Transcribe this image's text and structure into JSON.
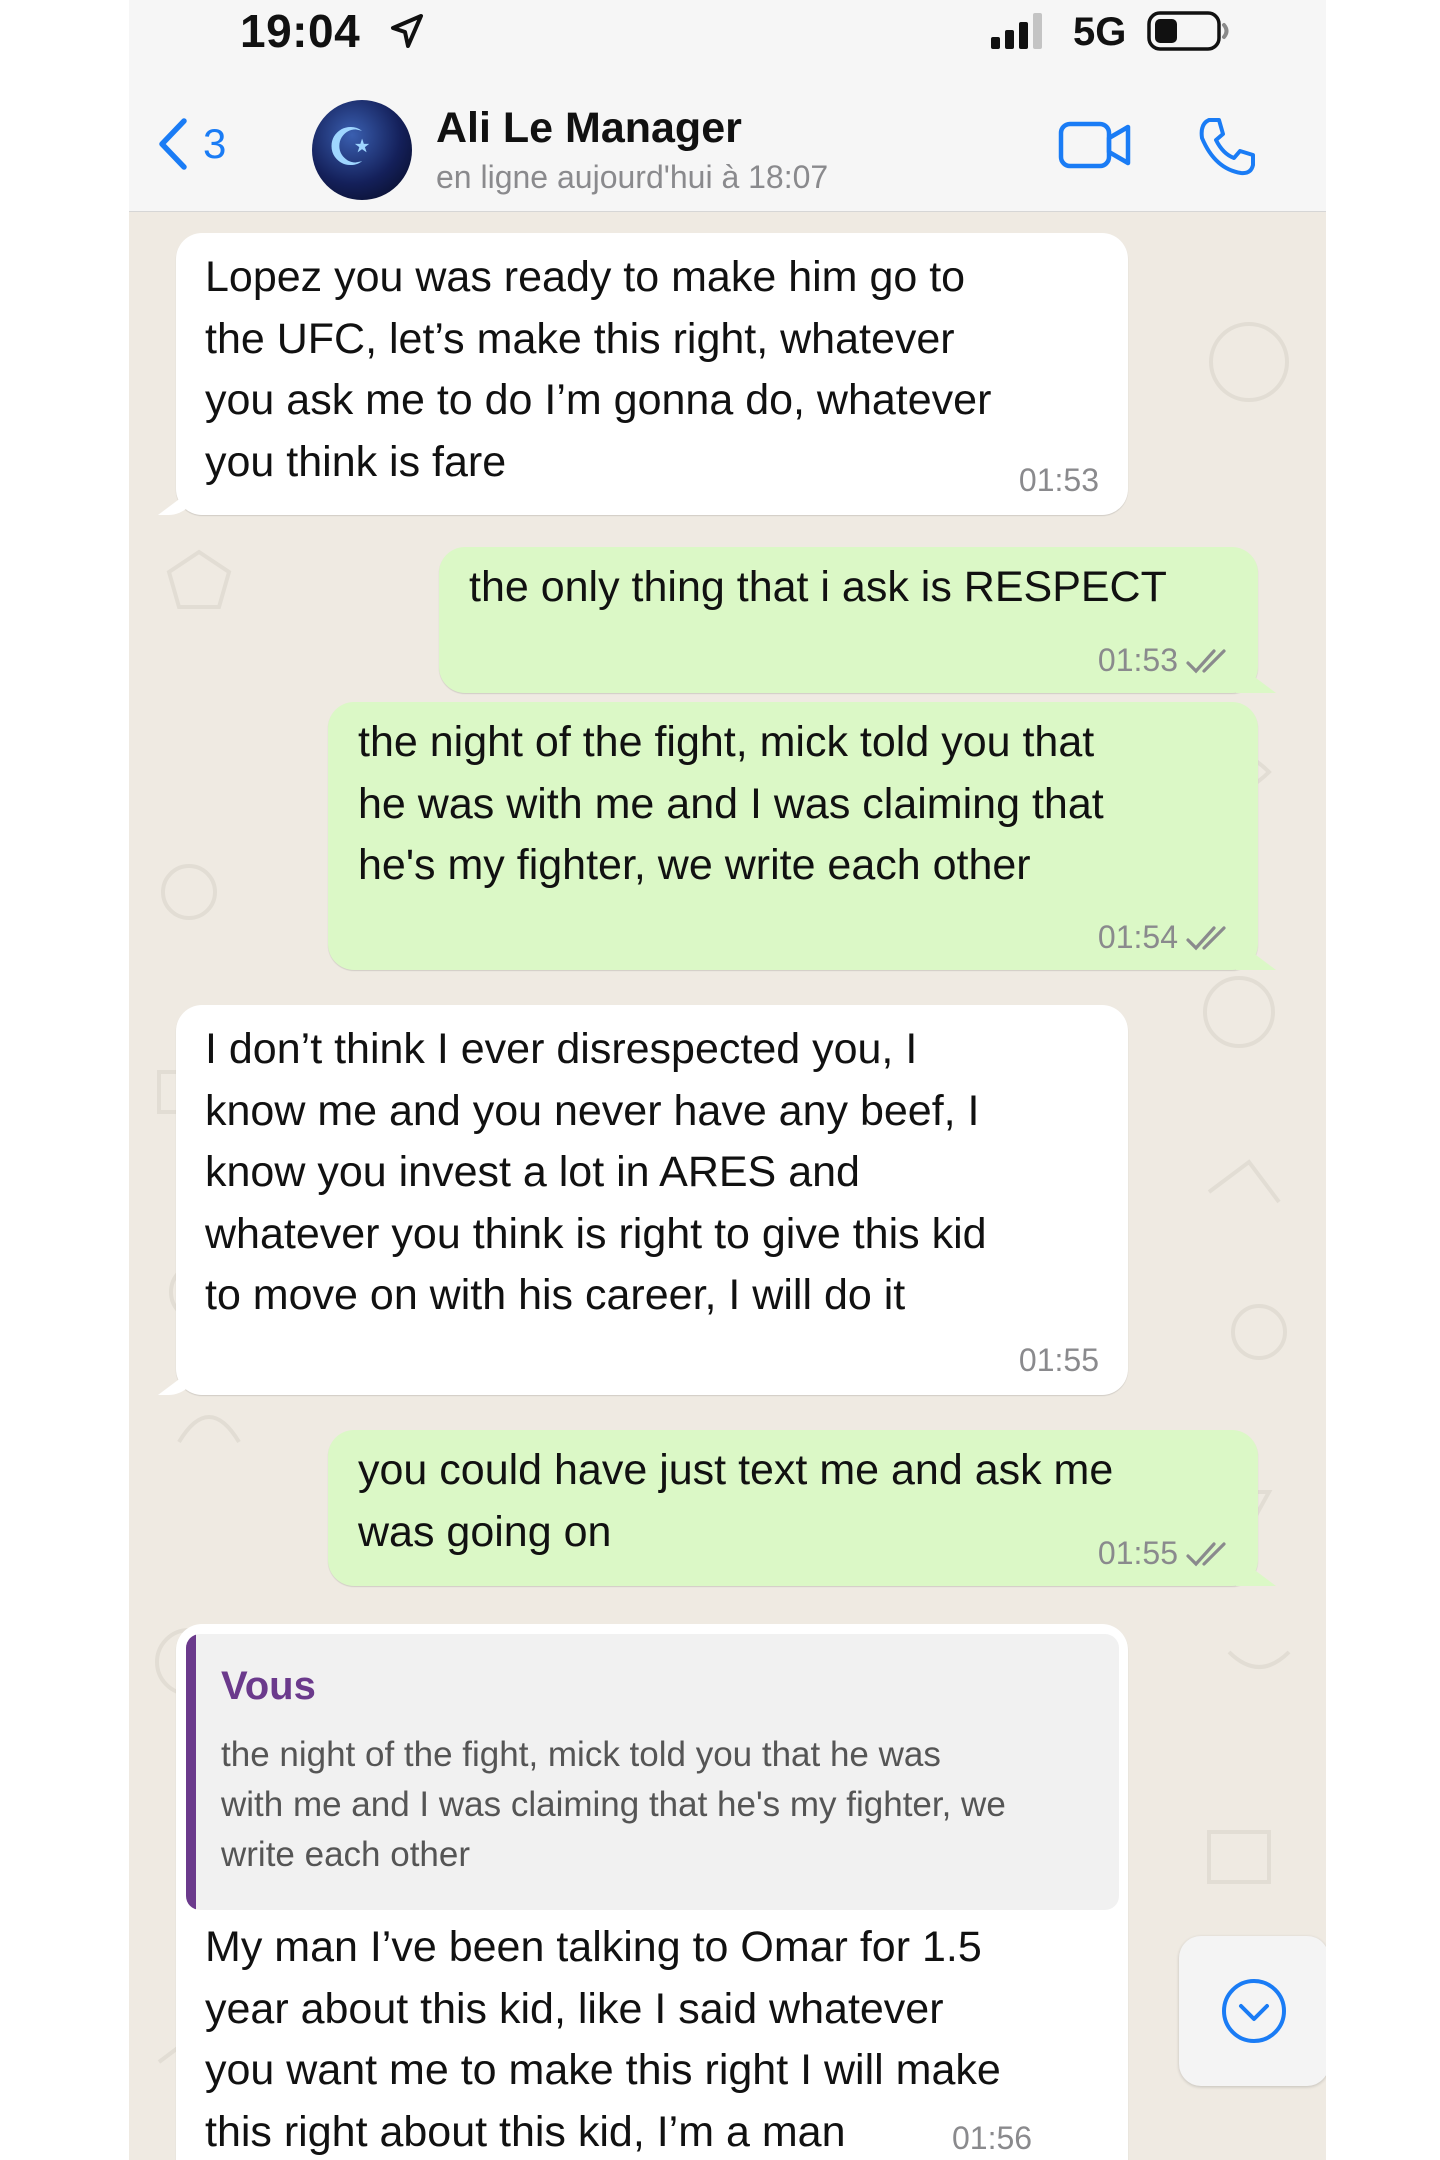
{
  "status_bar": {
    "time": "19:04",
    "network": "5G"
  },
  "header": {
    "back_count": "3",
    "contact_name": "Ali Le Manager",
    "contact_status": "en ligne aujourd'hui à 18:07"
  },
  "colors": {
    "accent": "#1a7cf5",
    "incoming_bubble": "#ffffff",
    "outgoing_bubble": "#dbf8c6",
    "reply_author": "#6b3a8c",
    "chat_background": "#efeae2"
  },
  "messages": [
    {
      "direction": "incoming",
      "text": "Lopez you was ready to make him go to\nthe UFC, let’s make this right, whatever\nyou ask me to do I’m gonna do, whatever\nyou think is fare",
      "time": "01:53"
    },
    {
      "direction": "outgoing",
      "text": "the only thing that i ask is RESPECT",
      "time": "01:53",
      "read": true
    },
    {
      "direction": "outgoing",
      "text": "the night of the fight, mick told you that\nhe was with me and I was claiming that\nhe's my fighter, we write each other",
      "time": "01:54",
      "read": true
    },
    {
      "direction": "incoming",
      "text": "I don’t think I ever disrespected you, I\nknow me and you never have any beef, I\nknow you invest a lot in ARES and\nwhatever you think is right to give this kid\nto move on with his career, I will do it",
      "time": "01:55"
    },
    {
      "direction": "outgoing",
      "text": "you could have just text me and ask me\nwas going on",
      "time": "01:55",
      "read": true
    },
    {
      "direction": "incoming",
      "reply_to": {
        "author": "Vous",
        "text": "the night of the fight, mick told you that he was\nwith me and I was claiming that he's my fighter, we\nwrite each other"
      },
      "text": "My man I’ve been talking to Omar for 1.5\nyear about this kid, like I said whatever\nyou want me to make this right I will make\nthis right about this kid, I’m a man",
      "time": "01:56"
    }
  ],
  "icons": {
    "location": "location-arrow-icon",
    "signal": "signal-bars-icon",
    "battery": "battery-icon",
    "back": "chevron-left-icon",
    "video": "video-camera-icon",
    "phone": "phone-icon",
    "read_receipt": "double-check-icon",
    "scroll_down": "chevron-down-icon"
  }
}
